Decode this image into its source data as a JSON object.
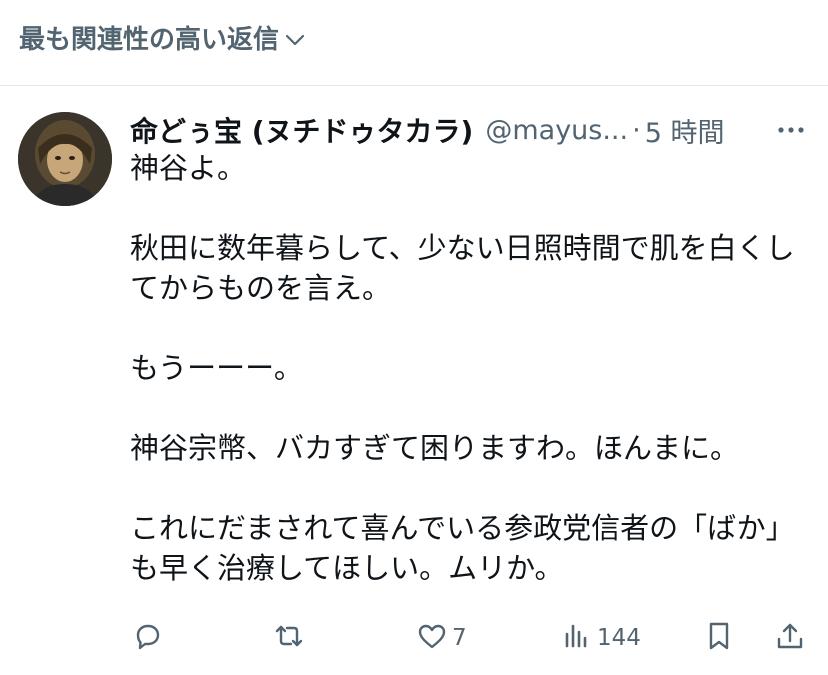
{
  "sort": {
    "label": "最も関連性の高い返信",
    "icon": "chevron-down-icon"
  },
  "tweet": {
    "display_name": "命どぅ宝 (ヌチドゥタカラ)",
    "handle": "@mayus...",
    "separator": "·",
    "time": "5 時間",
    "paragraphs": [
      "神谷よ。",
      "秋田に数年暮らして、少ない日照時間で肌を白くしてからものを言え。",
      "もうーーー。",
      "神谷宗幣、バカすぎて困りますわ。ほんまに。",
      "これにだまされて喜んでいる参政党信者の「ばか」も早く治療してほしい。ムリか。"
    ],
    "actions": {
      "reply": {
        "icon": "reply-icon",
        "count": ""
      },
      "repost": {
        "icon": "repost-icon",
        "count": ""
      },
      "like": {
        "icon": "heart-icon",
        "count": "7"
      },
      "views": {
        "icon": "analytics-icon",
        "count": "144"
      },
      "bookmark": {
        "icon": "bookmark-icon"
      },
      "share": {
        "icon": "share-icon"
      }
    }
  },
  "colors": {
    "text_primary": "#0f1419",
    "text_secondary": "#536471",
    "divider": "#e5e8ea"
  }
}
